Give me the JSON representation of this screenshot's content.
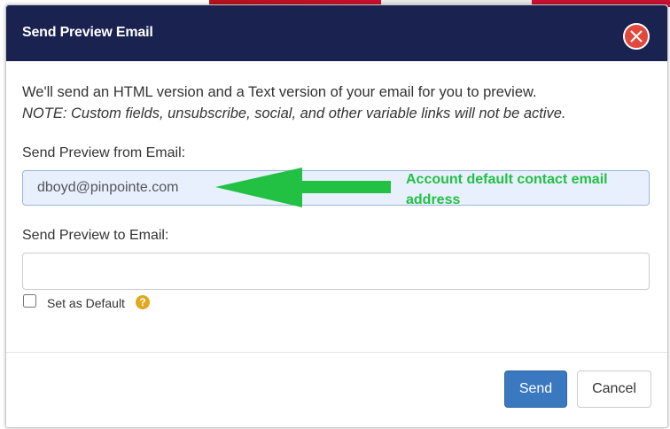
{
  "dialog": {
    "title": "Send Preview Email",
    "close_icon": "close-icon",
    "description": "We'll send an HTML version and a Text version of your email for you to preview.",
    "note": "NOTE: Custom fields, unsubscribe, social, and other variable links will not be active."
  },
  "from_email": {
    "label": "Send Preview from Email:",
    "value": "dboyd@pinpointe.com"
  },
  "annotation": {
    "text": "Account default contact email address",
    "color": "#22c144"
  },
  "to_email": {
    "label": "Send Preview to Email:",
    "value": "",
    "placeholder": ""
  },
  "set_default": {
    "label": "Set as Default",
    "checked": false,
    "help_icon": "?"
  },
  "buttons": {
    "send": "Send",
    "cancel": "Cancel"
  },
  "colors": {
    "header_bg": "#1a2350",
    "close_bg": "#e2483c",
    "send_bg": "#3a78c0",
    "help_bg": "#e1a820"
  }
}
